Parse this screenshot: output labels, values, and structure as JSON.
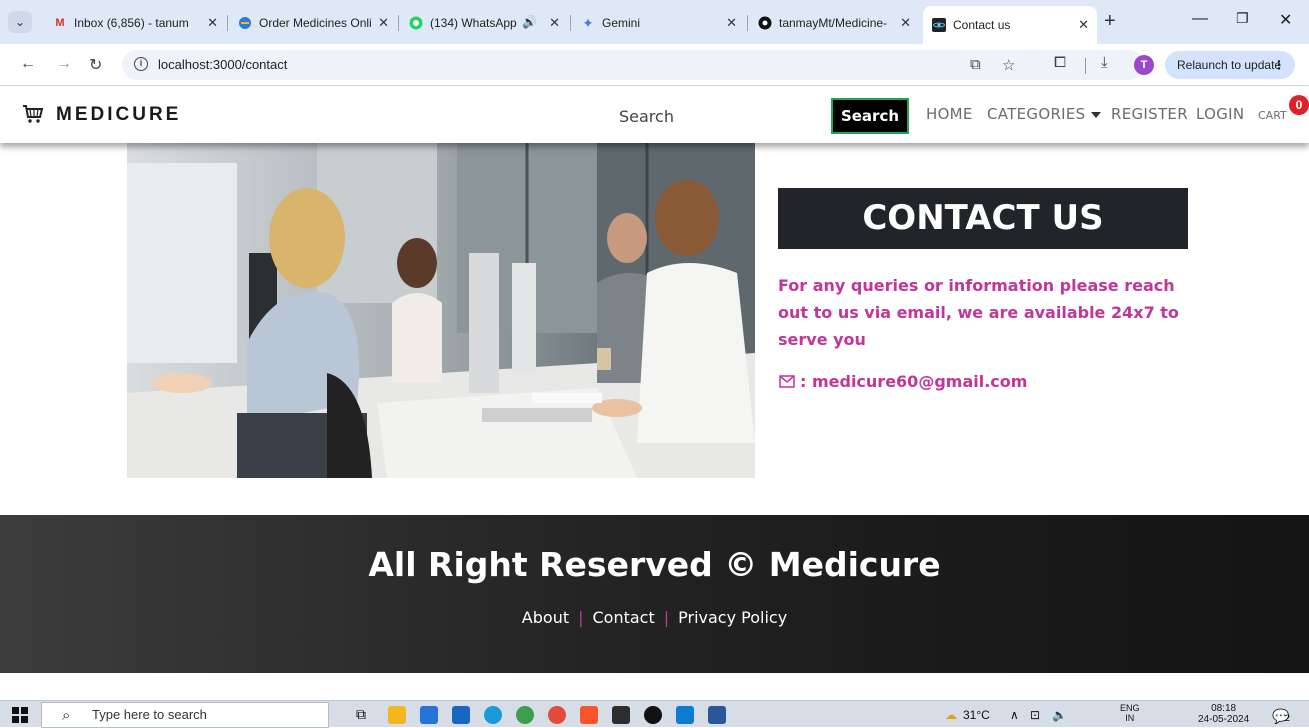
{
  "browser": {
    "tabs": [
      {
        "title": "Inbox (6,856) - tanum",
        "icon": "gmail-icon",
        "active": false
      },
      {
        "title": "Order Medicines Onli",
        "icon": "medicine-site-icon",
        "active": false
      },
      {
        "title": "(134) WhatsApp",
        "icon": "whatsapp-icon",
        "active": false
      },
      {
        "title": "Gemini",
        "icon": "gemini-icon",
        "active": false
      },
      {
        "title": "tanmayMt/Medicine-",
        "icon": "github-icon",
        "active": false
      },
      {
        "title": "Contact us",
        "icon": "react-icon",
        "active": true
      }
    ],
    "url": "localhost:3000/contact",
    "relaunch_label": "Relaunch to update",
    "profile_initial": "T"
  },
  "navbar": {
    "brand": "MEDICURE",
    "search_placeholder": "Search",
    "search_button": "Search",
    "links": {
      "home": "HOME",
      "categories": "CATEGORIES",
      "register": "REGISTER",
      "login": "LOGIN",
      "cart": "CART"
    },
    "cart_count": "0"
  },
  "contact": {
    "heading": "CONTACT US",
    "description": "For any queries or information please reach out to us via email, we are available 24x7 to serve you",
    "email_text": ": medicure60@gmail.com"
  },
  "footer": {
    "title": "All Right Reserved © Medicure",
    "links": [
      "About",
      "Contact",
      "Privacy Policy"
    ],
    "separator": "|"
  },
  "taskbar": {
    "search_placeholder": "Type here to search",
    "weather": "31°C",
    "lang_top": "ENG",
    "lang_bottom": "IN",
    "time": "08:18",
    "date": "24-05-2024",
    "notif_count": "2"
  },
  "colors": {
    "accent_pink": "#c2369a",
    "dark": "#212529",
    "badge_red": "#e0212b",
    "search_border": "#1fa55a"
  }
}
